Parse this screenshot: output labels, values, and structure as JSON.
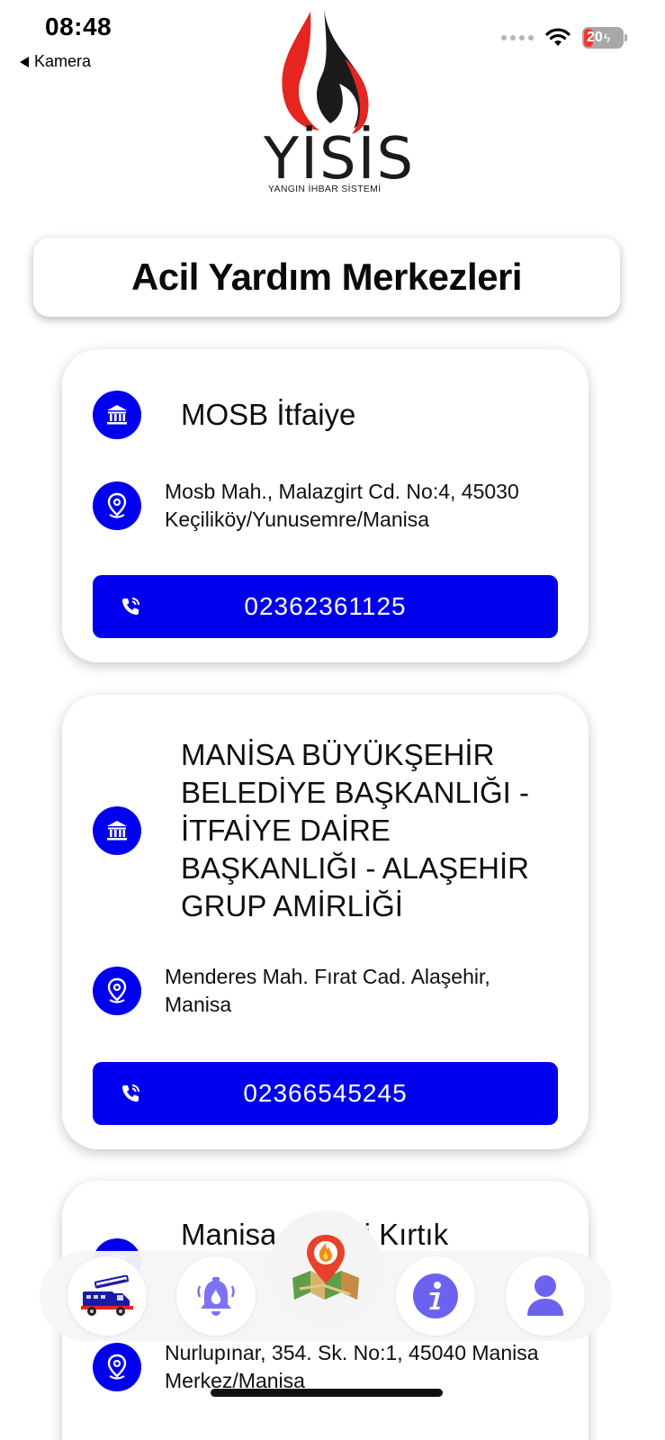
{
  "status_bar": {
    "time": "08:48",
    "back_label": "Kamera",
    "battery_level": "20"
  },
  "logo": {
    "name": "YİSİS",
    "subtitle": "YANGIN İHBAR SİSTEMİ",
    "flame_colors": [
      "#e52520",
      "#1b1b1b"
    ]
  },
  "page_title": "Acil Yardım Merkezleri",
  "colors": {
    "accent": "#0000ee",
    "nav_icon": "#6b63f0"
  },
  "stations": [
    {
      "name": "MOSB İtfaiye",
      "address": "Mosb Mah., Malazgirt Cd. No:4, 45030 Keçiliköy/Yunusemre/Manisa",
      "phone": "02362361125",
      "icons": [
        "bank-icon",
        "location-pin-icon",
        "phone-call-icon"
      ]
    },
    {
      "name": "MANİSA BÜYÜKŞEHİR BELEDİYE BAŞKANLIĞI - İTFAİYE DAİRE BAŞKANLIĞI - ALAŞEHİR GRUP AMİRLİĞİ",
      "address": "Menderes Mah. Fırat Cad. Alaşehir, Manisa",
      "phone": "02366545245",
      "icons": [
        "bank-icon",
        "location-pin-icon",
        "phone-call-icon"
      ]
    },
    {
      "name": "Manisa ... yesi Kırtık",
      "address": "Nurlupınar, 354. Sk. No:1, 45040 Manisa Merkez/Manisa",
      "icons": [
        "bank-icon",
        "location-pin-icon"
      ]
    }
  ],
  "bottom_nav": {
    "items": [
      "fire-truck-icon",
      "alarm-bell-icon",
      "fire-map-icon",
      "info-icon",
      "user-icon"
    ]
  }
}
